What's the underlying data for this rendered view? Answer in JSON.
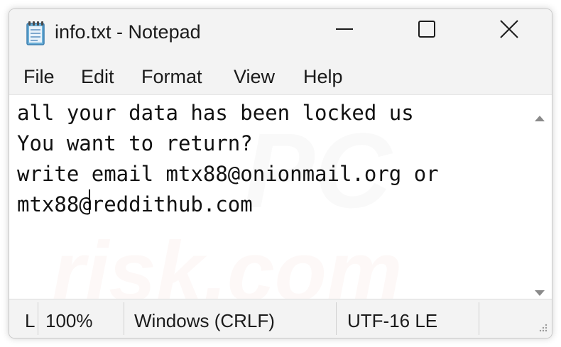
{
  "window": {
    "title": "info.txt - Notepad",
    "app_icon": "notepad-icon",
    "controls": {
      "minimize": "minimize-icon",
      "maximize": "maximize-icon",
      "close": "close-icon"
    }
  },
  "menu": {
    "items": [
      "File",
      "Edit",
      "Format",
      "View",
      "Help"
    ]
  },
  "editor": {
    "content": "all your data has been locked us\nYou want to return?\nwrite email mtx88@onionmail.org or\nmtx88@reddithub.com"
  },
  "watermark": {
    "text": "risk.com",
    "text_pc": "PC"
  },
  "statusbar": {
    "position": "L",
    "zoom": "100%",
    "line_ending": "Windows (CRLF)",
    "encoding": "UTF-16 LE"
  },
  "colors": {
    "chrome_bg": "#f3f3f3",
    "editor_bg": "#ffffff",
    "text": "#1b1b1b"
  }
}
